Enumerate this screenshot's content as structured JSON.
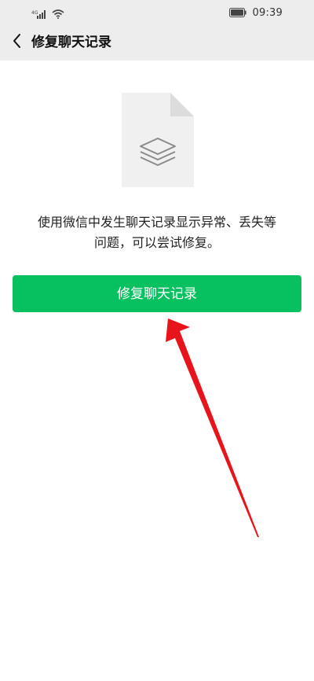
{
  "status_bar": {
    "signal_label": "4G",
    "time": "09:39",
    "icons": [
      "signal-icon",
      "wifi-icon",
      "battery-icon"
    ]
  },
  "header": {
    "back_icon": "chevron-left-icon",
    "title": "修复聊天记录"
  },
  "main": {
    "illustration_icon": "stacked-layers-file-icon",
    "description_line1": "使用微信中发生聊天记录显示异常、丢失等",
    "description_line2": "问题，可以尝试修复。",
    "repair_button_label": "修复聊天记录"
  },
  "colors": {
    "accent": "#07c160",
    "header_bg": "#ededed",
    "annotation_arrow": "#e8141b"
  }
}
